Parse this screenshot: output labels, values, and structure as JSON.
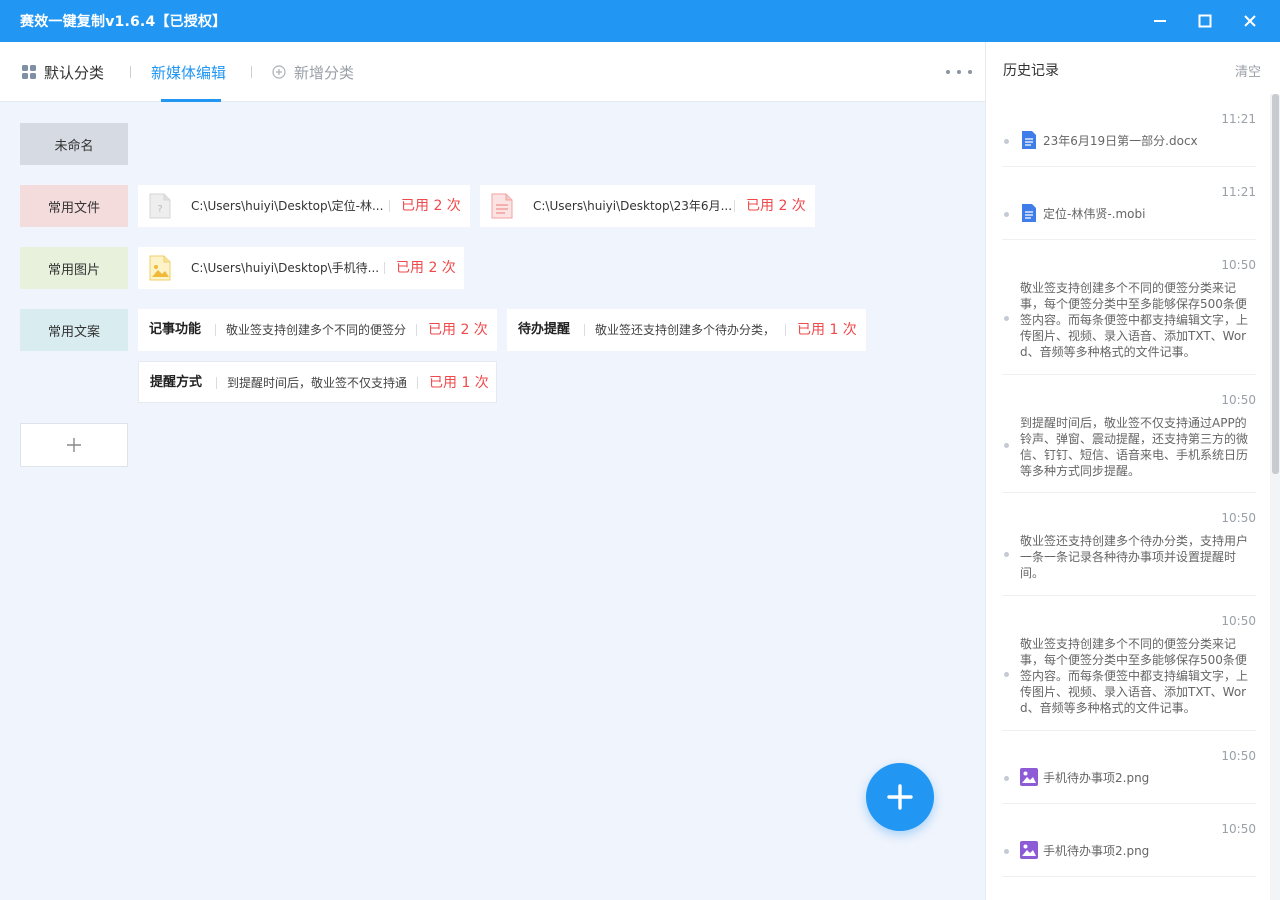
{
  "window": {
    "title": "赛效一键复制v1.6.4【已授权】"
  },
  "tabs": [
    {
      "label": "默认分类",
      "icon": "grid-icon"
    },
    {
      "label": "新媒体编辑",
      "active": true
    },
    {
      "label": "新增分类",
      "icon": "add-circle-icon"
    }
  ],
  "categories": [
    {
      "label": "未命名",
      "color": "#d6dae2"
    },
    {
      "label": "常用文件",
      "color": "#f4dcdd"
    },
    {
      "label": "常用图片",
      "color": "#e7f1dc"
    },
    {
      "label": "常用文案",
      "color": "#d9ecf0"
    }
  ],
  "files": [
    {
      "icon": "unknown-file-icon",
      "path": "C:\\Users\\huiyi\\Desktop\\定位-林...",
      "used": "已用 2 次"
    },
    {
      "icon": "document-file-icon",
      "path": "C:\\Users\\huiyi\\Desktop\\23年6月...",
      "used": "已用 2 次"
    }
  ],
  "images": [
    {
      "icon": "image-file-icon",
      "path": "C:\\Users\\huiyi\\Desktop\\手机待...",
      "used": "已用 2 次"
    }
  ],
  "texts": [
    {
      "name": "记事功能",
      "content": "敬业签支持创建多个不同的便签分",
      "used": "已用 2 次"
    },
    {
      "name": "待办提醒",
      "content": "敬业签还支持创建多个待办分类，",
      "used": "已用 1 次"
    },
    {
      "name": "提醒方式",
      "content": "到提醒时间后，敬业签不仅支持通",
      "used": "已用 1 次"
    }
  ],
  "history": {
    "title": "历史记录",
    "clear_label": "清空",
    "entries": [
      {
        "time": "11:21",
        "type": "doc",
        "icon": "word-doc-icon",
        "text": "23年6月19日第一部分.docx"
      },
      {
        "time": "11:21",
        "type": "doc",
        "icon": "word-doc-icon",
        "text": "定位-林伟贤-.mobi"
      },
      {
        "time": "10:50",
        "type": "text",
        "text": "敬业签支持创建多个不同的便签分类来记事，每个便签分类中至多能够保存500条便签内容。而每条便签中都支持编辑文字，上传图片、视频、录入语音、添加TXT、Word、音频等多种格式的文件记事。"
      },
      {
        "time": "10:50",
        "type": "text",
        "text": "到提醒时间后，敬业签不仅支持通过APP的铃声、弹窗、震动提醒，还支持第三方的微信、钉钉、短信、语音来电、手机系统日历等多种方式同步提醒。"
      },
      {
        "time": "10:50",
        "type": "text",
        "text": "敬业签还支持创建多个待办分类，支持用户一条一条记录各种待办事项并设置提醒时间。"
      },
      {
        "time": "10:50",
        "type": "text",
        "text": "敬业签支持创建多个不同的便签分类来记事，每个便签分类中至多能够保存500条便签内容。而每条便签中都支持编辑文字，上传图片、视频、录入语音、添加TXT、Word、音频等多种格式的文件记事。"
      },
      {
        "time": "10:50",
        "type": "image",
        "icon": "image-thumb-icon",
        "text": "手机待办事项2.png"
      },
      {
        "time": "10:50",
        "type": "image",
        "icon": "image-thumb-icon",
        "text": "手机待办事项2.png"
      }
    ]
  },
  "colors": {
    "primary": "#2196f3",
    "used": "#f0494b"
  }
}
